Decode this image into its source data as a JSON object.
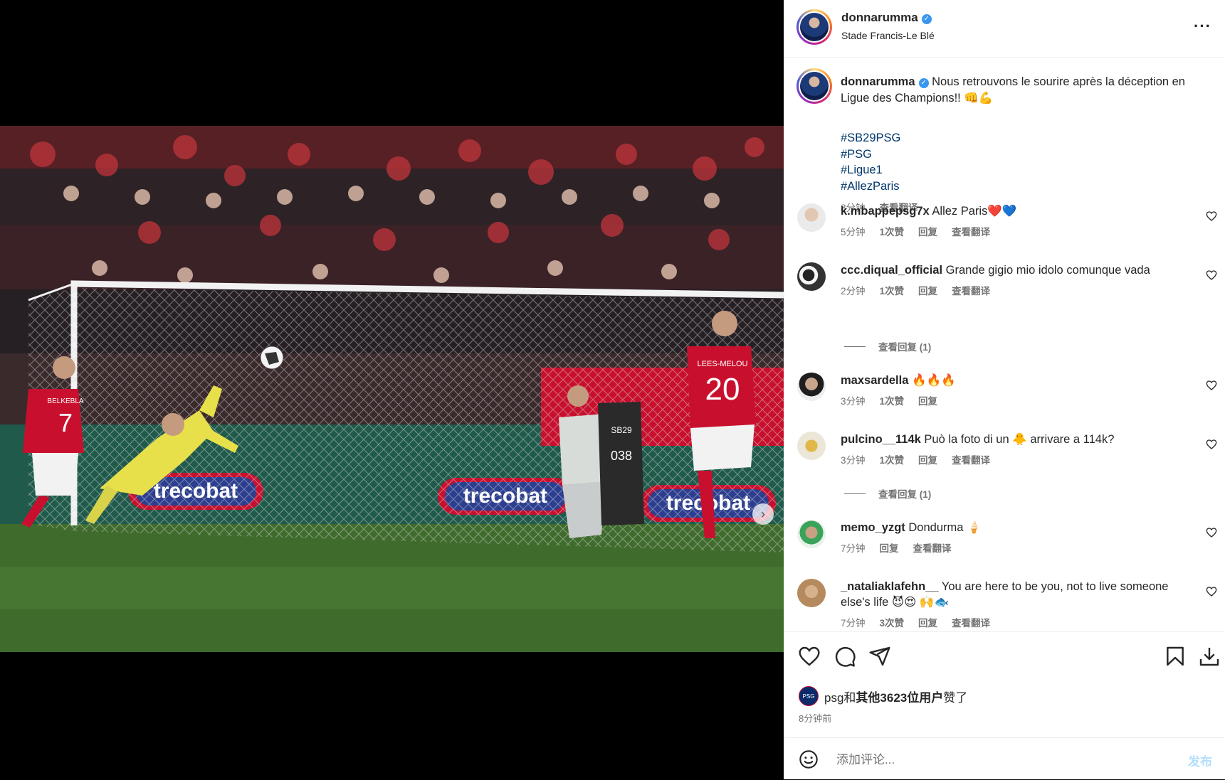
{
  "post": {
    "username": "donnarumma",
    "location": "Stade Francis-Le Blé",
    "more_icon": "more-horizontal-icon"
  },
  "photo": {
    "jersey_texts": [
      "BELKEBLA",
      "7",
      "LEES-MELOU",
      "20",
      "trecobat",
      "SB29",
      "038"
    ],
    "carousel_count": 2,
    "carousel_index": 1
  },
  "caption": {
    "username": "donnarumma",
    "text": "Nous retrouvons le sourire après la déception en Ligue des Champions!! 👊💪",
    "hashtags": [
      "#SB29PSG",
      "#PSG",
      "#Ligue1",
      "#AllezParis"
    ],
    "time": "8分钟",
    "translate": "查看翻译"
  },
  "comments": [
    {
      "user": "k.mbappepsg7x",
      "text": "Allez Paris❤️💙",
      "time": "5分钟",
      "likes": "1次赞",
      "reply": "回复",
      "translate": "查看翻译"
    },
    {
      "user": "ccc.diqual_official",
      "text": "Grande gigio mio idolo comunque vada",
      "time": "2分钟",
      "likes": "1次赞",
      "reply": "回复",
      "translate": "查看翻译",
      "view_replies": "查看回复 (1)"
    },
    {
      "user": "maxsardella",
      "text": "🔥🔥🔥",
      "time": "3分钟",
      "likes": "1次赞",
      "reply": "回复"
    },
    {
      "user": "pulcino__114k",
      "text": "Può la foto di un 🐥 arrivare a 114k?",
      "time": "3分钟",
      "likes": "1次赞",
      "reply": "回复",
      "translate": "查看翻译",
      "view_replies": "查看回复 (1)"
    },
    {
      "user": "memo_yzgt",
      "text": "Dondurma 🍦",
      "time": "7分钟",
      "reply": "回复",
      "translate": "查看翻译"
    },
    {
      "user": "_nataliaklafehn__",
      "text": "You are here to be you, not to live someone else's life 😈😍 🙌🐟",
      "time": "7分钟",
      "likes": "3次赞",
      "reply": "回复",
      "translate": "查看翻译"
    }
  ],
  "actions": {
    "likes_prefix": "psg和",
    "likes_bold": "其他3623位用户",
    "likes_suffix": "赞了",
    "time_ago": "8分钟前"
  },
  "add_comment": {
    "placeholder": "添加评论...",
    "post_label": "发布"
  },
  "colors": {
    "link": "#00376b",
    "verified": "#3897f0",
    "muted": "#737373",
    "post_button": "#b2dffc",
    "home_red": "#c8102e",
    "keeper_yellow": "#e8e04a"
  }
}
